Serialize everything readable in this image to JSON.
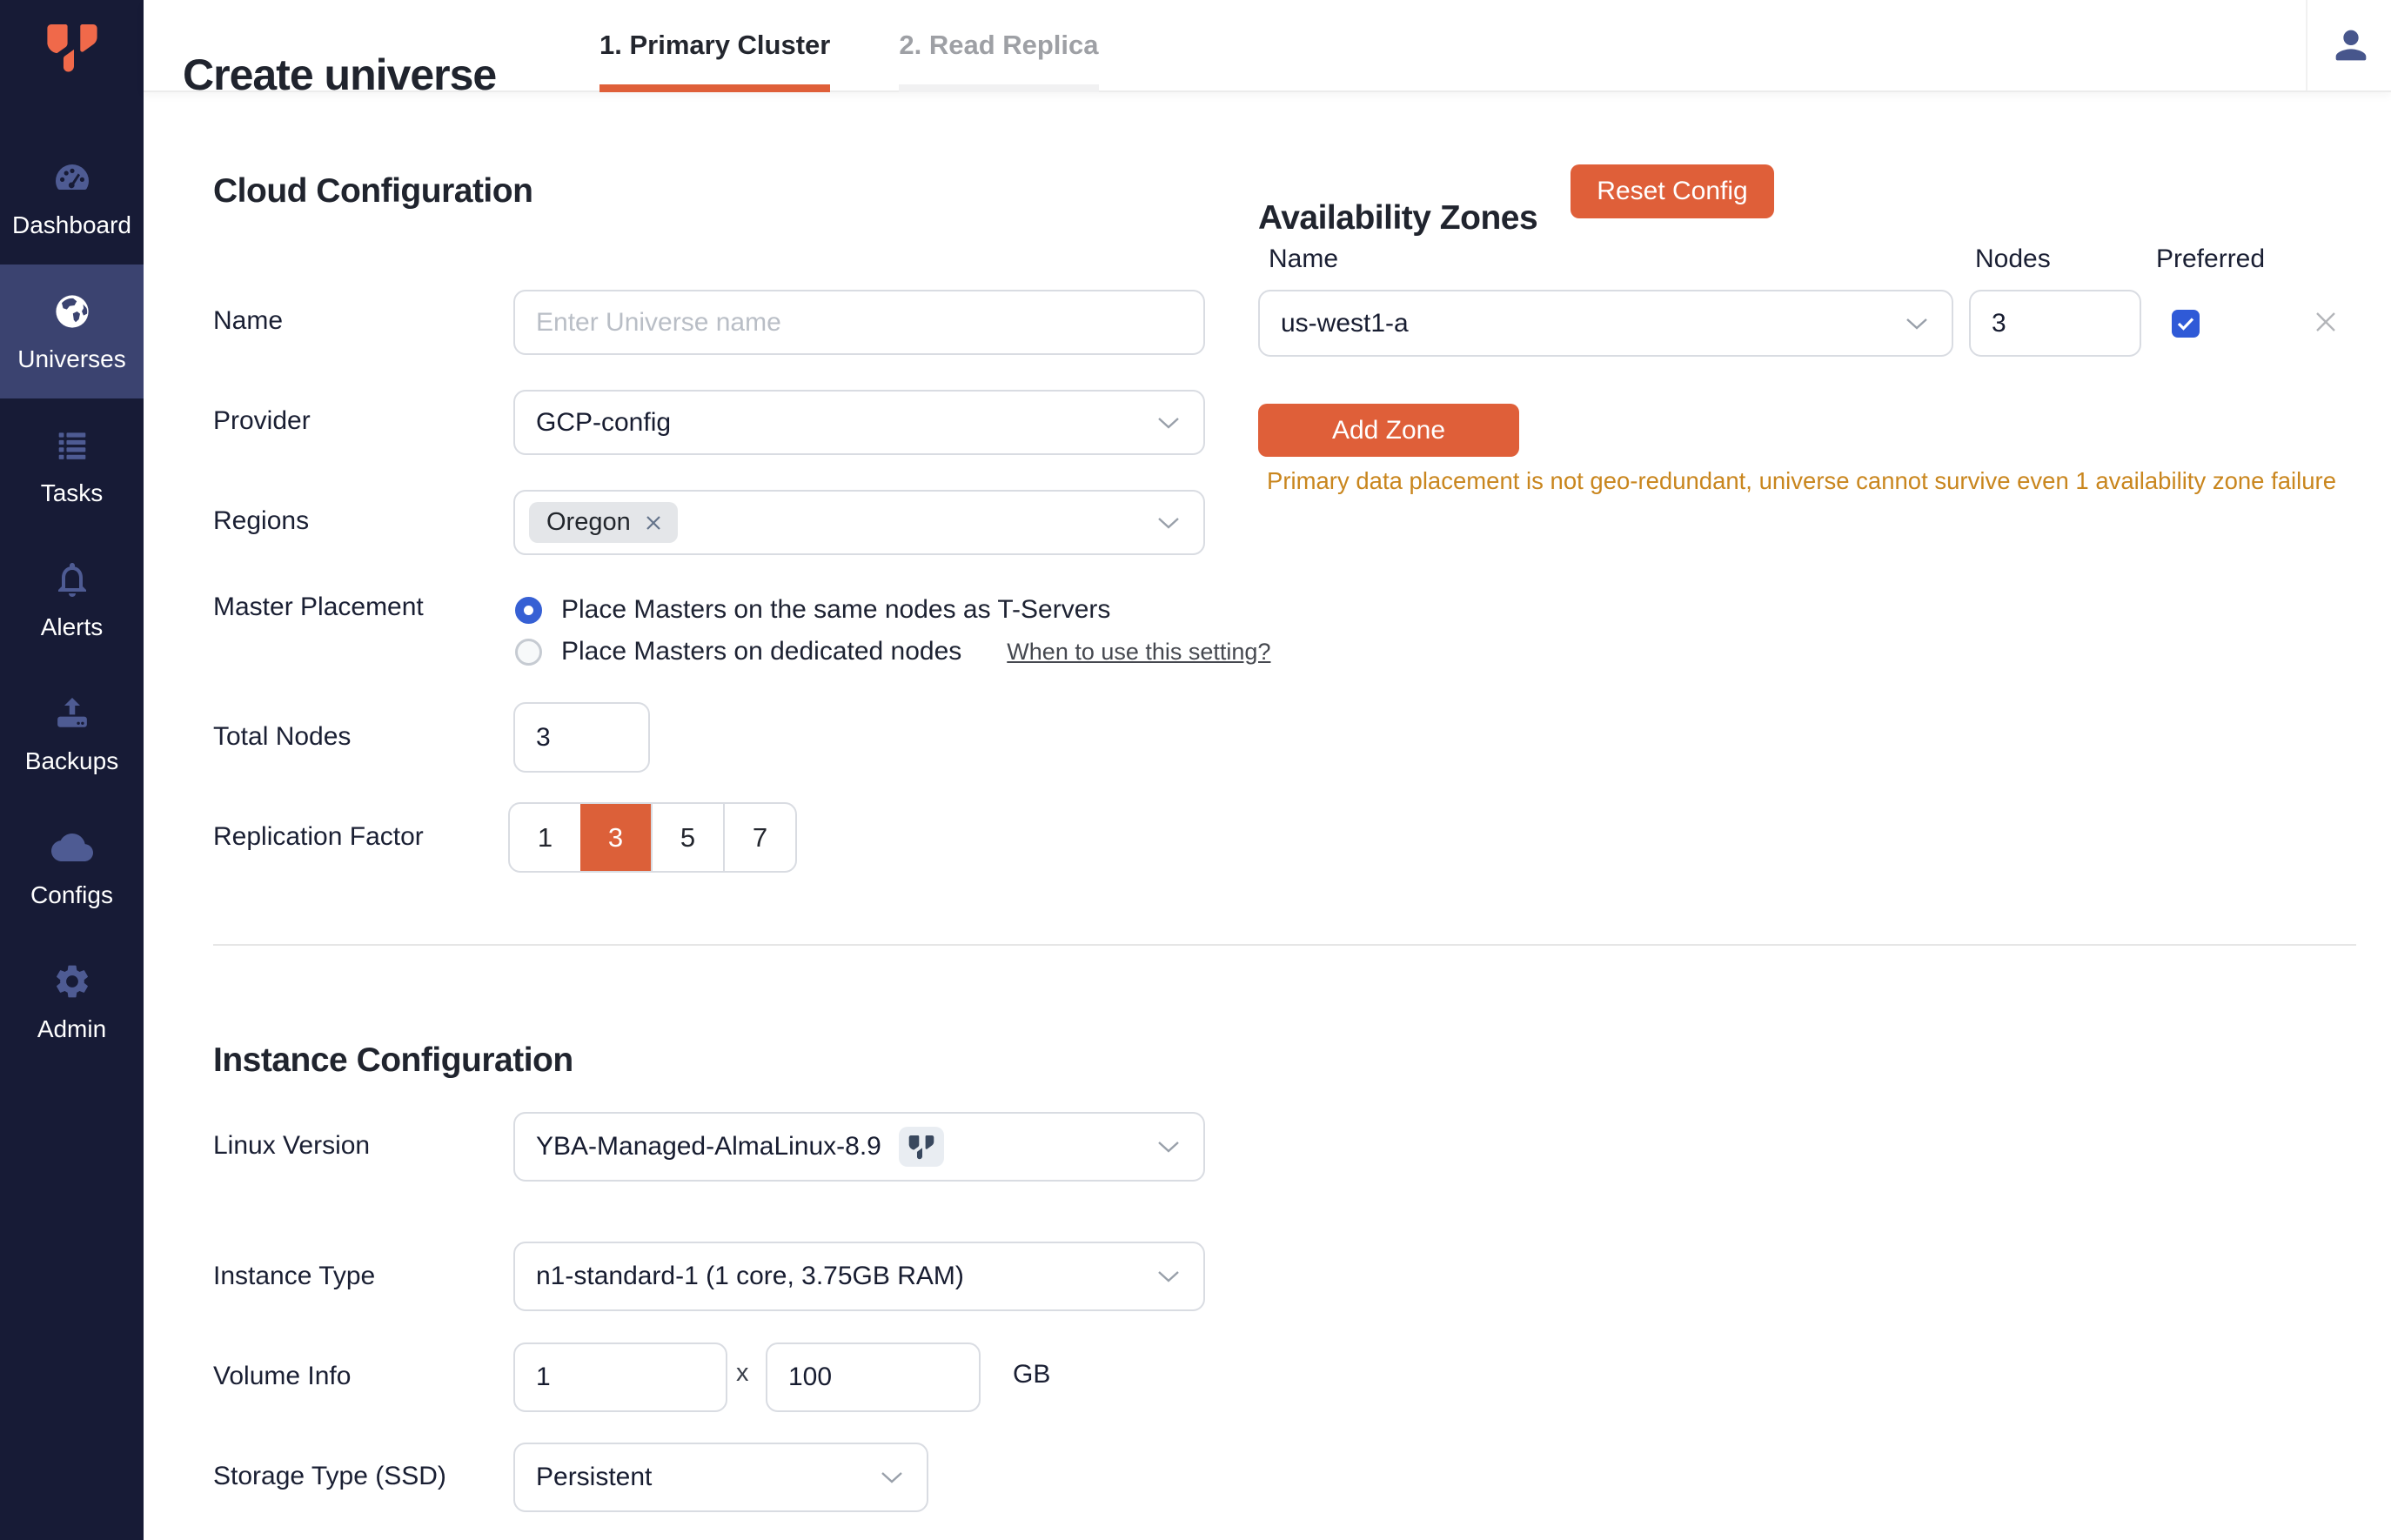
{
  "colors": {
    "accent_orange": "#DF5F39",
    "logo_orange": "#F0694A",
    "sidebar_navy": "#171B36",
    "sidebar_active": "#3B4370",
    "checkbox_blue": "#2F5AD7",
    "radio_blue": "#3660D4",
    "warning_amber": "#C9861E"
  },
  "sidebar": {
    "items": [
      {
        "label": "Dashboard",
        "icon": "gauge-icon",
        "active": false
      },
      {
        "label": "Universes",
        "icon": "globe-icon",
        "active": true
      },
      {
        "label": "Tasks",
        "icon": "task-list-icon",
        "active": false
      },
      {
        "label": "Alerts",
        "icon": "bell-icon",
        "active": false
      },
      {
        "label": "Backups",
        "icon": "backup-upload-icon",
        "active": false
      },
      {
        "label": "Configs",
        "icon": "cloud-upload-icon",
        "active": false
      },
      {
        "label": "Admin",
        "icon": "gear-icon",
        "active": false
      }
    ]
  },
  "header": {
    "title": "Create universe",
    "tabs": [
      {
        "label": "1. Primary Cluster",
        "active": true
      },
      {
        "label": "2. Read Replica",
        "active": false
      }
    ]
  },
  "cloud_config": {
    "heading": "Cloud Configuration",
    "name": {
      "label": "Name",
      "placeholder": "Enter Universe name",
      "value": ""
    },
    "provider": {
      "label": "Provider",
      "value": "GCP-config"
    },
    "regions": {
      "label": "Regions",
      "chip": "Oregon"
    },
    "master_placement": {
      "label": "Master Placement",
      "options": [
        {
          "label": "Place Masters on the same nodes as T-Servers",
          "selected": true
        },
        {
          "label": "Place Masters on dedicated nodes",
          "selected": false
        }
      ],
      "help_link": "When to use this setting?"
    },
    "total_nodes": {
      "label": "Total Nodes",
      "value": "3"
    },
    "replication_factor": {
      "label": "Replication Factor",
      "options": [
        "1",
        "3",
        "5",
        "7"
      ],
      "selected": "3"
    }
  },
  "availability_zones": {
    "heading": "Availability Zones",
    "reset_button": "Reset Config",
    "columns": {
      "name": "Name",
      "nodes": "Nodes",
      "preferred": "Preferred"
    },
    "zones": [
      {
        "name": "us-west1-a",
        "nodes": "3",
        "preferred": true
      }
    ],
    "add_zone_button": "Add Zone",
    "warning": "Primary data placement is not geo-redundant, universe cannot survive even 1 availability zone failure"
  },
  "instance_config": {
    "heading": "Instance Configuration",
    "linux_version": {
      "label": "Linux Version",
      "value": "YBA-Managed-AlmaLinux-8.9"
    },
    "instance_type": {
      "label": "Instance Type",
      "value": "n1-standard-1 (1 core, 3.75GB RAM)"
    },
    "volume_info": {
      "label": "Volume Info",
      "num_volumes": "1",
      "multiply_symbol": "x",
      "volume_size": "100",
      "unit": "GB"
    },
    "storage_type": {
      "label": "Storage Type (SSD)",
      "value": "Persistent"
    }
  }
}
